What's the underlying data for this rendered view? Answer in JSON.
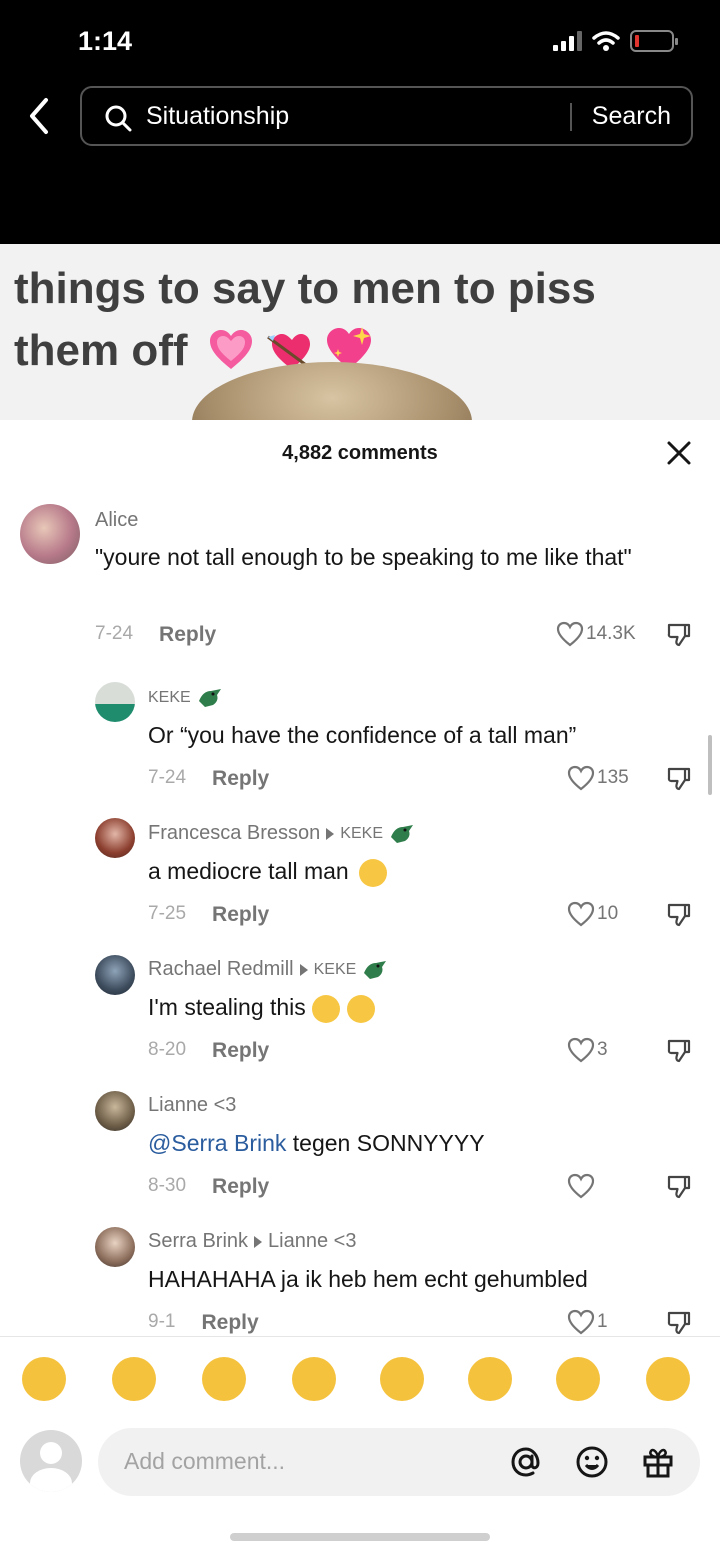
{
  "status": {
    "time": "1:14"
  },
  "search": {
    "query": "Situationship",
    "button": "Search"
  },
  "video": {
    "caption": "things to say to men to piss them off",
    "caption_emojis": [
      "pink-heart-icon",
      "heart-arrow-icon",
      "sparkling-heart-icon"
    ]
  },
  "comments_header": {
    "count_label": "4,882 comments"
  },
  "comments": [
    {
      "user": "Alice",
      "text": "\"youre not tall enough to be speaking to me like that\"",
      "date": "7-24",
      "reply": "Reply",
      "likes": "14.3K"
    },
    {
      "user": "KEKE",
      "text": "Or “you have the confidence of a tall man”",
      "date": "7-24",
      "reply": "Reply",
      "likes": "135"
    },
    {
      "user": "Francesca Bresson",
      "reply_to": "KEKE",
      "text": "a mediocre tall man",
      "date": "7-25",
      "reply": "Reply",
      "likes": "10"
    },
    {
      "user": "Rachael Redmill",
      "reply_to": "KEKE",
      "text": "I'm stealing this",
      "date": "8-20",
      "reply": "Reply",
      "likes": "3"
    },
    {
      "user": "Lianne <3",
      "mention": "@Serra Brink",
      "text": " tegen SONNYYYY",
      "date": "8-30",
      "reply": "Reply",
      "likes": ""
    },
    {
      "user": "Serra Brink",
      "reply_to": "Lianne <3",
      "text": "HAHAHAHA ja ik heb hem echt gehumbled",
      "date": "9-1",
      "reply": "Reply",
      "likes": "1"
    }
  ],
  "emoji_bar": [
    "flushed-face-icon",
    "grinning-face-icon",
    "smiling-face-hearts-icon",
    "tears-of-joy-icon",
    "smirking-face-icon",
    "grinning-sweat-icon",
    "pleading-face-icon",
    "relieved-face-icon"
  ],
  "composer": {
    "placeholder": "Add comment..."
  },
  "colors": {
    "mention": "#2a5c9e",
    "emoji": "#f5c23e"
  }
}
